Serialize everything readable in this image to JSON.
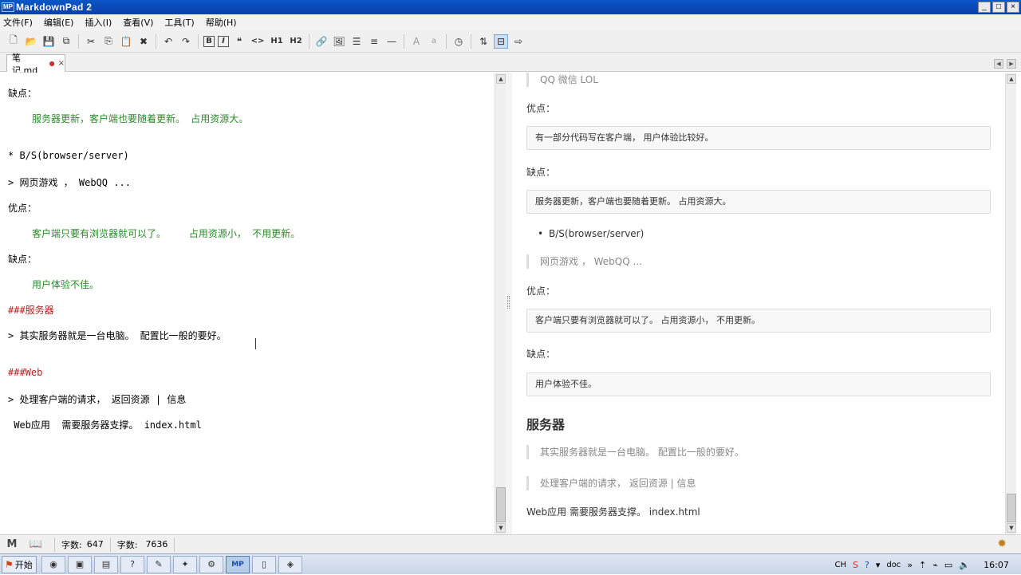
{
  "window": {
    "app_icon": "MP",
    "title": "MarkdownPad 2",
    "controls": [
      "_",
      "□",
      "×"
    ]
  },
  "menu": [
    "文件(F)",
    "编辑(E)",
    "插入(I)",
    "查看(V)",
    "工具(T)",
    "帮助(H)"
  ],
  "toolbar": {
    "bold": "B",
    "italic": "I",
    "quote": "❝",
    "code": "<>",
    "h1": "H1",
    "h2": "H2",
    "font_big": "A",
    "font_small": "a"
  },
  "tab": {
    "label": "笔记.md",
    "modified_mark": "●",
    "close": "×"
  },
  "editor": {
    "lines": [
      {
        "text": "缺点：",
        "style": "plain",
        "indent": false
      },
      {
        "text": "服务器更新，客户端也要随着更新。 占用资源大。",
        "style": "green",
        "indent": true
      },
      {
        "text": "* B/S(browser/server)",
        "style": "plain",
        "indent": false
      },
      {
        "text": "> 网页游戏 ， WebQQ ...",
        "style": "plain",
        "indent": false
      },
      {
        "text": "优点：",
        "style": "plain",
        "indent": false
      },
      {
        "text": "客户端只要有浏览器就可以了。    占用资源小， 不用更新。",
        "style": "green",
        "indent": true
      },
      {
        "text": "缺点：",
        "style": "plain",
        "indent": false
      },
      {
        "text": "用户体验不佳。",
        "style": "green",
        "indent": true
      },
      {
        "text": "###服务器",
        "style": "red",
        "indent": false
      },
      {
        "text": "> 其实服务器就是一台电脑。 配置比一般的要好。",
        "style": "plain",
        "indent": false
      },
      {
        "text": "###Web",
        "style": "red",
        "indent": false
      },
      {
        "text": "> 处理客户端的请求， 返回资源 | 信息",
        "style": "plain",
        "indent": false
      },
      {
        "text": " Web应用  需要服务器支撑。 index.html",
        "style": "plain",
        "indent": false
      }
    ]
  },
  "preview": {
    "quote_top": "QQ 微信 LOL",
    "pros_label_1": "优点：",
    "pros_code_1": "有一部分代码写在客户端， 用户体验比较好。",
    "cons_label_1": "缺点：",
    "cons_code_1": "服务器更新，客户端也要随着更新。 占用资源大。",
    "bullet_bs": "B/S(browser/server)",
    "quote_web": "网页游戏 ， WebQQ ...",
    "pros_label_2": "优点：",
    "pros_code_2": "客户端只要有浏览器就可以了。   占用资源小， 不用更新。",
    "cons_label_2": "缺点：",
    "cons_code_2": "用户体验不佳。",
    "heading_server": "服务器",
    "quote_server": "其实服务器就是一台电脑。 配置比一般的要好。",
    "quote_request": "处理客户端的请求， 返回资源 | 信息",
    "para_web": "Web应用 需要服务器支撑。 index.html"
  },
  "status": {
    "words_label": "字数:",
    "words": "647",
    "chars_label": "字数:",
    "chars": "7636"
  },
  "taskbar": {
    "start_label": "开始",
    "tasks": [
      "chrome",
      "app",
      "folder",
      "help",
      "notes",
      "tool",
      "settings",
      "MP",
      "doc",
      "misc"
    ],
    "tray_lang": "CH",
    "tray_doc": "doc",
    "clock": "16:07"
  }
}
